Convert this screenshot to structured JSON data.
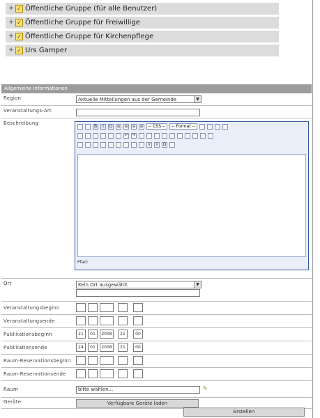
{
  "groups": [
    {
      "label": "Öffentliche Gruppe (für alle Benutzer)"
    },
    {
      "label": "Öffentliche Gruppe für Freiwillige"
    },
    {
      "label": "Öffentliche Gruppe für Kirchenpflege"
    },
    {
      "label": "Urs Gamper"
    }
  ],
  "section": {
    "title": "Allgemeine Informationen"
  },
  "fields": {
    "region": {
      "label": "Region",
      "value": "Aktuelle Mitteilungen aus der Gemeinde"
    },
    "event_type": {
      "label": "Veranstaltungs-Art"
    },
    "description": {
      "label": "Beschreibung"
    },
    "location": {
      "label": "Ort",
      "value": "Kein Ort ausgewählt"
    },
    "event_start": {
      "label": "Veranstaltungsbeginn"
    },
    "event_end": {
      "label": "Veranstaltungsende"
    },
    "pub_start": {
      "label": "Publikationsbeginn",
      "day": "21",
      "month": "01",
      "year": "2008",
      "hour": "21",
      "minute": "00"
    },
    "pub_end": {
      "label": "Publikationsende",
      "day": "24",
      "month": "01",
      "year": "2008",
      "hour": "21",
      "minute": "00"
    },
    "room_start": {
      "label": "Raum-Reservationsbeginn"
    },
    "room_end": {
      "label": "Raum-Reservationsende"
    },
    "room": {
      "label": "Raum",
      "value": "bitte wählen..."
    },
    "devices": {
      "label": "Geräte",
      "button": "Verfügbare Geräte laden"
    }
  },
  "editor": {
    "status": "Pfad:",
    "font_family": "-- CSS --",
    "font_size": "-- Format --"
  },
  "submit_label": "Erstellen",
  "colors": {
    "header_bg": "#9c9c9c",
    "group_bg": "#dcdcdc",
    "editor_border": "#2f5aa2"
  }
}
